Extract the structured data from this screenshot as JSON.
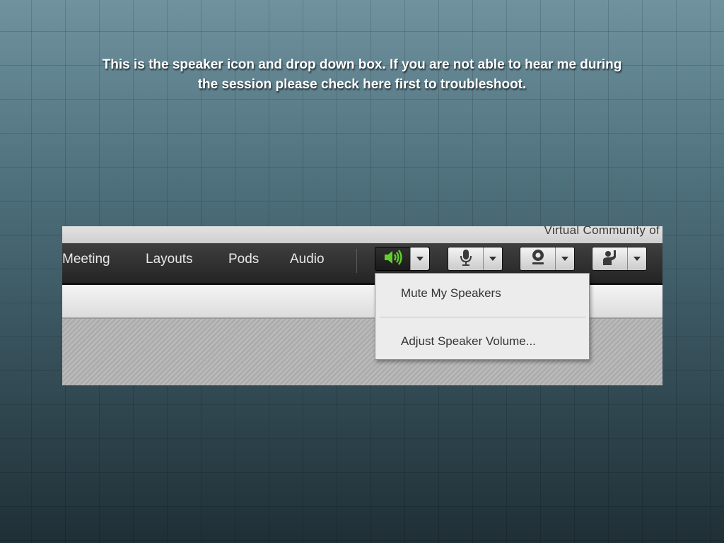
{
  "slide": {
    "caption_line1": "This is the speaker icon and drop down box.  If you are not able to hear me during",
    "caption_line2": "the session please check here first to troubleshoot."
  },
  "app": {
    "org_name": "Virtual Community of",
    "menu": [
      "Meeting",
      "Layouts",
      "Pods",
      "Audio"
    ],
    "toolbar": [
      {
        "icon": "speaker-icon",
        "active": true
      },
      {
        "icon": "microphone-icon",
        "active": false
      },
      {
        "icon": "webcam-icon",
        "active": false
      },
      {
        "icon": "raise-hand-icon",
        "active": false
      }
    ],
    "speaker_menu": {
      "items": [
        "Mute My Speakers",
        "Adjust Speaker Volume..."
      ]
    }
  },
  "colors": {
    "speaker_active": "#5fd12a",
    "menubar": "#2e2e2e"
  }
}
